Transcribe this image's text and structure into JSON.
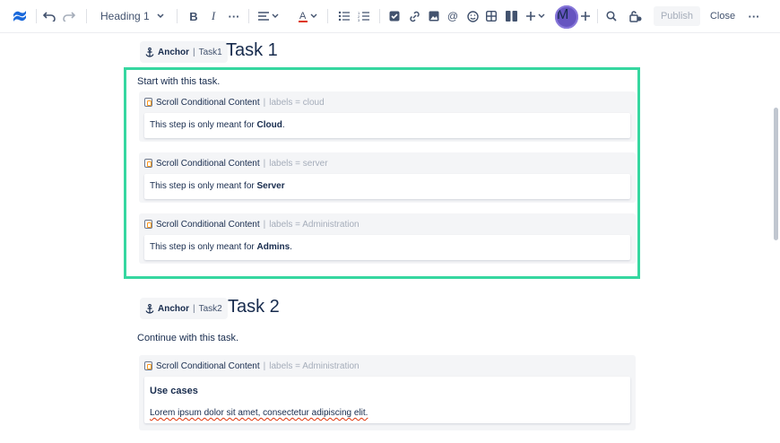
{
  "toolbar": {
    "heading_label": "Heading 1",
    "publish_label": "Publish",
    "close_label": "Close",
    "avatar_badge": "M"
  },
  "task1": {
    "anchor_label": "Anchor",
    "anchor_sep": "|",
    "anchor_id": "Task1",
    "title": "Task 1",
    "intro": "Start with this task.",
    "macros": [
      {
        "title": "Scroll Conditional Content",
        "sep": "|",
        "param": "labels = cloud",
        "prefix": "This step is only meant for ",
        "bold": "Cloud",
        "suffix": "."
      },
      {
        "title": "Scroll Conditional Content",
        "sep": "|",
        "param": "labels = server",
        "prefix": "This step is only meant for ",
        "bold": "Server",
        "suffix": ""
      },
      {
        "title": "Scroll Conditional Content",
        "sep": "|",
        "param": "labels = Administration",
        "prefix": "This step is only meant for ",
        "bold": "Admins",
        "suffix": "."
      }
    ]
  },
  "task2": {
    "anchor_label": "Anchor",
    "anchor_sep": "|",
    "anchor_id": "Task2",
    "title": "Task 2",
    "intro": "Continue with this task.",
    "macro": {
      "title": "Scroll Conditional Content",
      "sep": "|",
      "param": "labels = Administration",
      "heading": "Use cases",
      "body": "Lorem ipsum dolor sit amet, consectetur adipiscing elit."
    }
  },
  "colors": {
    "highlight_border": "#36d7a0",
    "logo": "#1868db"
  }
}
